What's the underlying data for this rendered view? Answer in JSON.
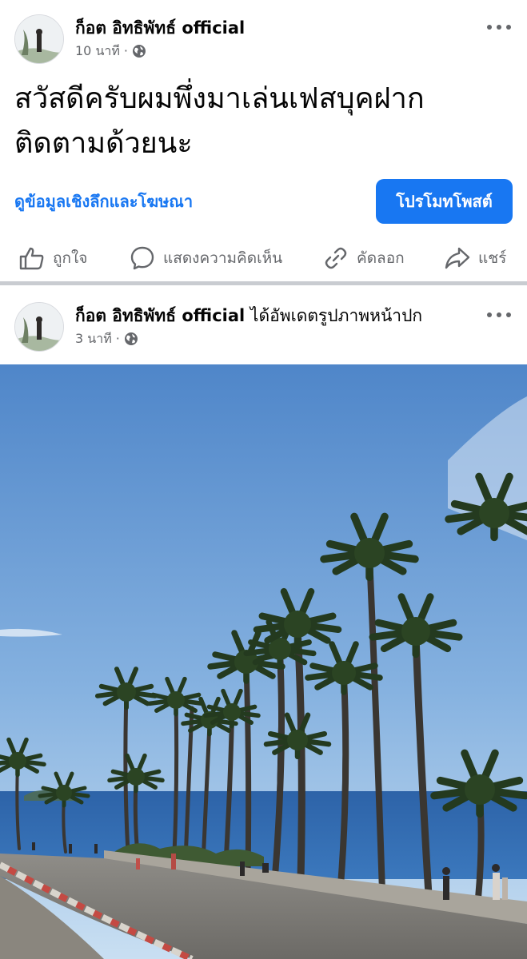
{
  "posts": [
    {
      "author": "ก็อต อิทธิพัทธ์ official",
      "action_text": "",
      "time": "10 นาที",
      "text_line1": "สวัสดีครับผมพึ่งมาเล่นเฟสบุคฝาก",
      "text_line2": "ติดตามด้วยนะ",
      "insights_link": "ดูข้อมูลเชิงลึกและโฆษณา",
      "promote_button": "โปรโมทโพสต์",
      "actions": {
        "like": "ถูกใจ",
        "comment": "แสดงความคิดเห็น",
        "copy": "คัดลอก",
        "share": "แชร์"
      }
    },
    {
      "author": "ก็อต อิทธิพัทธ์ official",
      "action_text": " ได้อัพเดตรูปภาพหน้าปก",
      "time": "3 นาที"
    }
  ],
  "colors": {
    "accent": "#1877f2",
    "secondary_text": "#65676b",
    "divider": "#c9ccd1"
  },
  "icons": {
    "audience": "globe-icon",
    "more": "more-dots-icon",
    "like": "thumbs-up-icon",
    "comment": "comment-bubble-icon",
    "copy": "link-icon",
    "share": "share-arrow-icon"
  }
}
